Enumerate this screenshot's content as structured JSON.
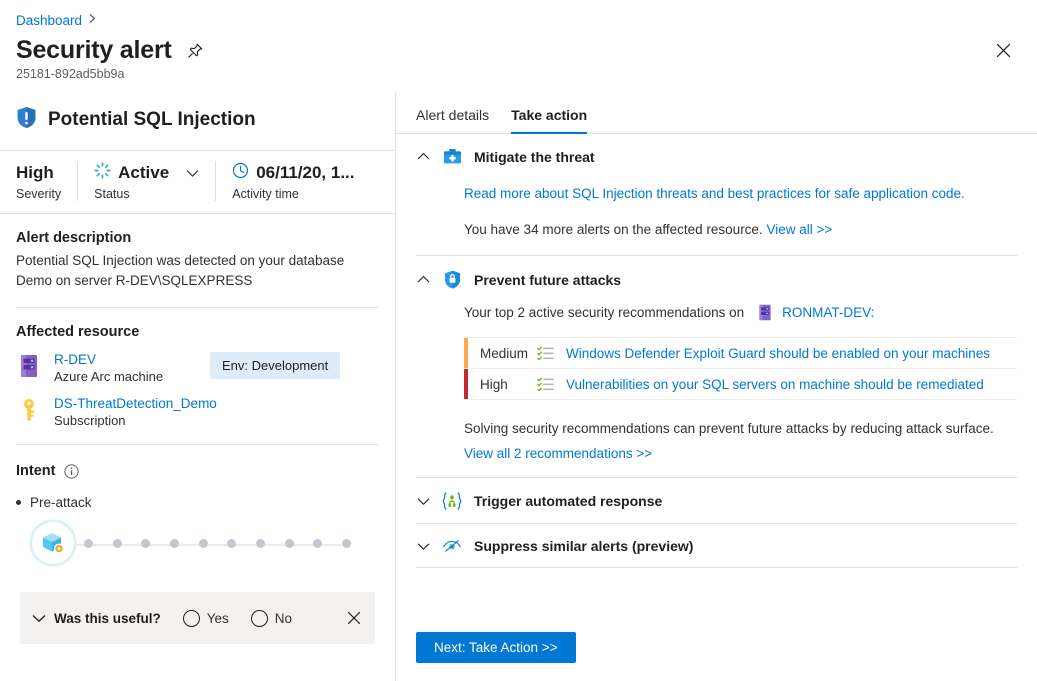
{
  "header": {
    "breadcrumb": "Dashboard",
    "breadcrumb_chevron": "chevron-right-icon",
    "title": "Security alert",
    "pin_icon": "pin-icon",
    "alert_id": "25181-892ad5bb9a",
    "close_icon": "close-icon"
  },
  "alert": {
    "shield_icon": "shield-alert-icon",
    "name": "Potential SQL Injection",
    "severity": {
      "value": "High",
      "label": "Severity"
    },
    "status": {
      "value": "Active",
      "label": "Status",
      "icon": "spinner-icon",
      "chevron": "chevron-down-icon"
    },
    "activity_time": {
      "value": "06/11/20, 1...",
      "label": "Activity time",
      "icon": "clock-icon"
    }
  },
  "description": {
    "heading": "Alert description",
    "text": "Potential SQL Injection was detected on your database Demo on server R-DEV\\SQLEXPRESS"
  },
  "affected_resource": {
    "heading": "Affected resource",
    "items": [
      {
        "icon": "server-icon",
        "name": "R-DEV",
        "type": "Azure Arc machine",
        "tag": "Env: Development"
      },
      {
        "icon": "key-icon",
        "name": "DS-ThreatDetection_Demo",
        "type": "Subscription",
        "tag": ""
      }
    ]
  },
  "intent": {
    "heading": "Intent",
    "info_icon": "info-icon",
    "stage": "Pre-attack",
    "killchain_icon": "cube-icon",
    "dot_count": 10
  },
  "feedback": {
    "chevron": "chevron-down-icon",
    "question": "Was this useful?",
    "yes": "Yes",
    "no": "No",
    "close_icon": "close-icon"
  },
  "tabs": [
    {
      "label": "Alert details",
      "active": false
    },
    {
      "label": "Take action",
      "active": true
    }
  ],
  "sections": {
    "mitigate": {
      "chevron": "chevron-up-icon",
      "icon": "first-aid-kit-icon",
      "title": "Mitigate the threat",
      "link": "Read more about SQL Injection threats and best practices for safe application code.",
      "alerts_text_before": "You have 34 more alerts on the affected resource.",
      "alerts_link": "View all >>"
    },
    "prevent": {
      "chevron": "chevron-up-icon",
      "icon": "shield-lock-icon",
      "title": "Prevent future attacks",
      "intro_before": "Your top 2 active security recommendations on",
      "resource_icon": "server-icon",
      "resource_name": "RONMAT-DEV:",
      "recommendations": [
        {
          "severity": "Medium",
          "severity_color": "#f9a94c",
          "icon": "checklist-icon",
          "text": "Windows Defender Exploit Guard should be enabled on your machines"
        },
        {
          "severity": "High",
          "severity_color": "#be2b2b",
          "icon": "checklist-icon",
          "text": "Vulnerabilities on your SQL servers on machine should be remediated"
        }
      ],
      "note": "Solving security recommendations can prevent future attacks by reducing attack surface.",
      "view_all_link": "View all 2 recommendations >>"
    },
    "trigger": {
      "chevron": "chevron-down-icon",
      "icon": "logic-app-icon",
      "title": "Trigger automated response"
    },
    "suppress": {
      "chevron": "chevron-down-icon",
      "icon": "eye-hide-icon",
      "title": "Suppress similar alerts (preview)"
    }
  },
  "footer": {
    "next_button": "Next: Take Action >>"
  },
  "colors": {
    "accent": "#0078d4",
    "link": "#0078d4",
    "severity_high": "#be2b2b",
    "severity_medium": "#f9a94c",
    "tag_bg": "#deecf9"
  }
}
